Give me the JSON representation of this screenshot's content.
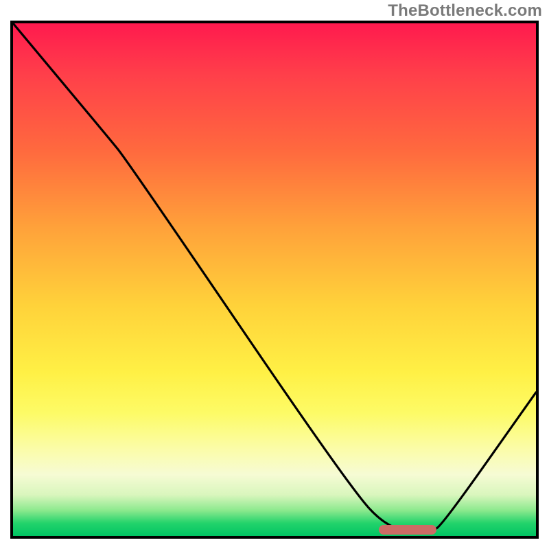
{
  "watermark": "TheBottleneck.com",
  "chart_data": {
    "type": "line",
    "title": "",
    "xlabel": "",
    "ylabel": "",
    "xlim": [
      0,
      100
    ],
    "ylim": [
      0,
      100
    ],
    "series": [
      {
        "name": "bottleneck-curve",
        "x": [
          0,
          18,
          22,
          64,
          72,
          80,
          82,
          100
        ],
        "values": [
          100,
          78,
          73,
          10,
          1,
          1,
          2,
          28
        ]
      }
    ],
    "marker": {
      "name": "optimal-range",
      "x_start": 70,
      "x_end": 81,
      "y": 1.2
    },
    "gradient_stops": [
      {
        "pos": 0,
        "color": "#ff1a4e"
      },
      {
        "pos": 25,
        "color": "#ff6a3e"
      },
      {
        "pos": 55,
        "color": "#ffd23a"
      },
      {
        "pos": 76,
        "color": "#fdfb66"
      },
      {
        "pos": 92,
        "color": "#d9f6bd"
      },
      {
        "pos": 100,
        "color": "#00c463"
      }
    ]
  }
}
